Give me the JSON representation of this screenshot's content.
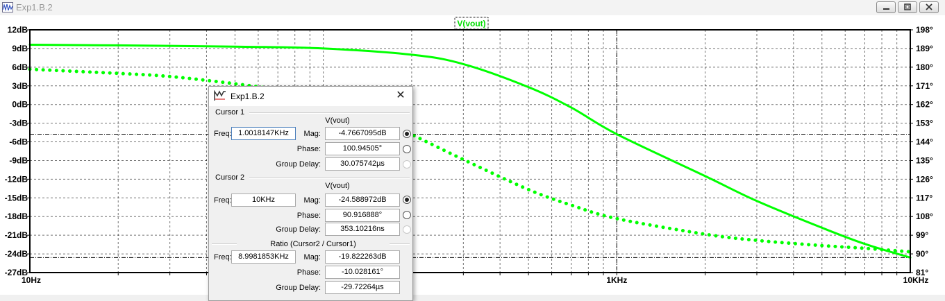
{
  "window": {
    "title": "Exp1.B.2"
  },
  "plot": {
    "trace_label": "V(vout)",
    "colors": {
      "trace": "#00ff00",
      "grid": "#000000",
      "frame": "#000000",
      "cursor_line": "#000000"
    },
    "left_axis_labels": [
      "12dB",
      "9dB",
      "6dB",
      "3dB",
      "0dB",
      "-3dB",
      "-6dB",
      "-9dB",
      "-12dB",
      "-15dB",
      "-18dB",
      "-21dB",
      "-24dB",
      "-27dB"
    ],
    "right_axis_labels": [
      "198°",
      "189°",
      "180°",
      "171°",
      "162°",
      "153°",
      "144°",
      "135°",
      "126°",
      "117°",
      "108°",
      "99°",
      "90°",
      "81°"
    ],
    "x_axis_labels": [
      "10Hz",
      "1KHz",
      "10KHz"
    ]
  },
  "chart_data": {
    "type": "line",
    "x_scale": "log",
    "xlim": [
      10,
      10000
    ],
    "ylim_left": [
      -27,
      12
    ],
    "ylim_right": [
      81,
      198
    ],
    "left_unit": "dB",
    "right_unit": "°",
    "series": [
      {
        "name": "V(vout)",
        "axis": "left",
        "style": "solid",
        "x": [
          10,
          20,
          50,
          100,
          200,
          300,
          500,
          700,
          1000,
          2000,
          3000,
          5000,
          7000,
          10000
        ],
        "y": [
          9.6,
          9.5,
          9.3,
          9.0,
          8.0,
          6.5,
          2.8,
          -0.5,
          -4.77,
          -11.5,
          -15.5,
          -19.8,
          -22.4,
          -24.59
        ]
      },
      {
        "name": "V(vout) phase",
        "axis": "right",
        "style": "dotted",
        "x": [
          10,
          20,
          30,
          50,
          70,
          100,
          150,
          200,
          300,
          500,
          700,
          1000,
          2000,
          3000,
          5000,
          7000,
          10000
        ],
        "y": [
          179,
          177,
          175.5,
          172,
          169,
          164,
          155.5,
          147.5,
          135.5,
          121,
          113.5,
          107,
          99.5,
          96.5,
          94,
          92.7,
          91
        ]
      }
    ],
    "cursor_lines": [
      {
        "freq": 1000.0,
        "mag_db": -4.7667095
      },
      {
        "freq": 10000.0,
        "mag_db": -24.588972
      }
    ]
  },
  "dialog": {
    "title": "Exp1.B.2",
    "close_glyph": "✕",
    "cursor1": {
      "heading": "Cursor 1",
      "trace": "V(vout)",
      "freq_label": "Freq:",
      "freq": "1.0018147KHz",
      "mag_label": "Mag:",
      "mag": "-4.7667095dB",
      "phase_label": "Phase:",
      "phase": "100.94505°",
      "gd_label": "Group Delay:",
      "gd": "30.075742µs"
    },
    "cursor2": {
      "heading": "Cursor 2",
      "trace": "V(vout)",
      "freq_label": "Freq:",
      "freq": "10KHz",
      "mag_label": "Mag:",
      "mag": "-24.588972dB",
      "phase_label": "Phase:",
      "phase": "90.916888°",
      "gd_label": "Group Delay:",
      "gd": "353.10216ns"
    },
    "ratio": {
      "heading": "Ratio (Cursor2 / Cursor1)",
      "freq_label": "Freq:",
      "freq": "8.9981853KHz",
      "mag_label": "Mag:",
      "mag": "-19.822263dB",
      "phase_label": "Phase:",
      "phase": "-10.028161°",
      "gd_label": "Group Delay:",
      "gd": "-29.72264µs"
    }
  }
}
